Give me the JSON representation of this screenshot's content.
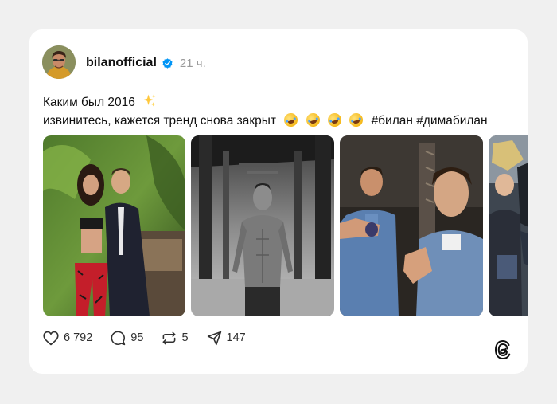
{
  "post": {
    "username": "bilanofficial",
    "time": "21 ч.",
    "text_line1": "Каким был 2016",
    "text_line2": "извинитесь, кажется тренд снова закрыт",
    "hashtags": "#билан #димабилан",
    "emoji_line1": "sparkles-emoji",
    "emoji_line2": [
      "rolling-laughing-emoji",
      "rolling-laughing-emoji",
      "rolling-laughing-emoji",
      "rolling-laughing-emoji"
    ]
  },
  "stats": {
    "likes": "6 792",
    "replies": "95",
    "reposts": "5",
    "shares": "147"
  },
  "icons": {
    "verified": "verified-badge-icon",
    "like": "heart-icon",
    "reply": "speech-bubble-icon",
    "repost": "repost-icon",
    "share": "send-icon",
    "brand": "threads-logo-icon"
  },
  "colors": {
    "page_bg": "#f0f0f0",
    "card_bg": "#ffffff",
    "verified_blue": "#0095f6",
    "muted_text": "#999999"
  }
}
